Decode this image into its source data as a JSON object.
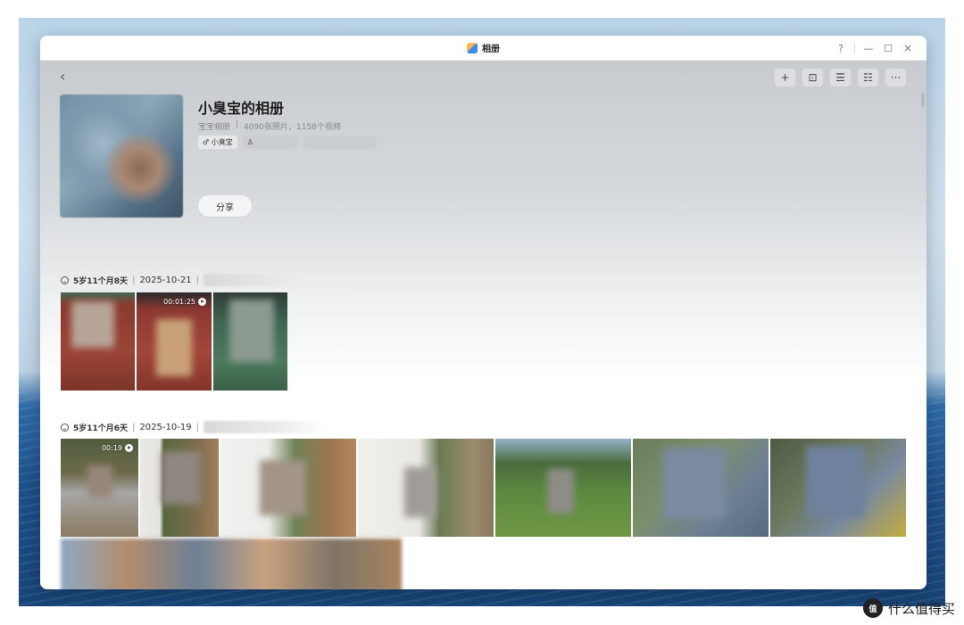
{
  "window": {
    "app_title": "相册",
    "help_label": "?",
    "minimize_label": "—",
    "maximize_label": "☐",
    "close_label": "✕"
  },
  "toolbar": {
    "back_label": "‹",
    "add_label": "+",
    "face_label": "⊡",
    "sort_label": "☰",
    "view_label": "☷",
    "more_label": "···"
  },
  "album": {
    "title": "小臭宝的相册",
    "type": "宝宝相册",
    "meta_sep": "|",
    "counts": "4090张照片，1158个视频",
    "tag_child": "♂ 小臭宝",
    "tag_parent_icon": "♙",
    "share_label": "分享"
  },
  "groups": [
    {
      "age": "5岁11个月8天",
      "date": "2025-10-21",
      "sep": "|",
      "durations": [
        "00:01:25"
      ]
    },
    {
      "age": "5岁11个月6天",
      "date": "2025-10-19",
      "sep": "|",
      "durations": [
        "00:19"
      ]
    }
  ],
  "watermark": {
    "logo": "值",
    "text": "什么值得买"
  }
}
